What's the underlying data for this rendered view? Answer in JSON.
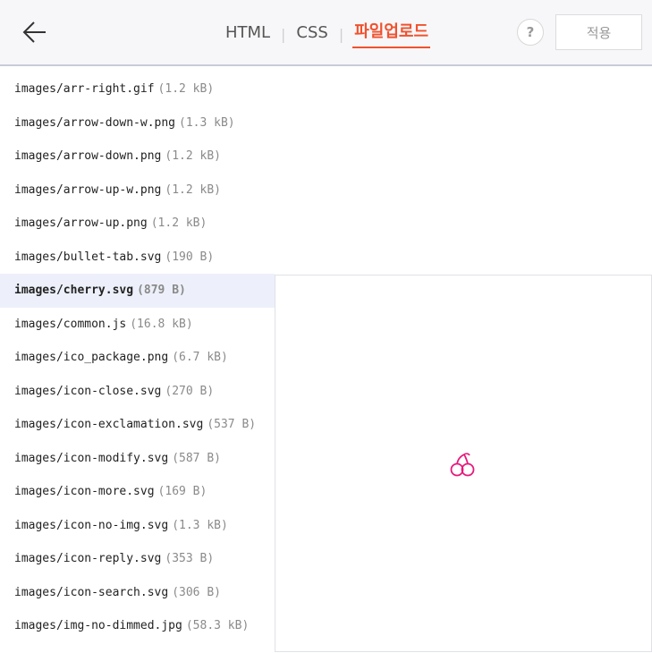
{
  "header": {
    "back_icon": "arrow-left-icon",
    "tabs": [
      {
        "label": "HTML",
        "active": false
      },
      {
        "label": "CSS",
        "active": false
      },
      {
        "label": "파일업로드",
        "active": true
      }
    ],
    "help_label": "?",
    "apply_label": "적용",
    "accent_color": "#f0522e"
  },
  "files": [
    {
      "name": "images/arr-right.gif",
      "size": "(1.2 kB)"
    },
    {
      "name": "images/arrow-down-w.png",
      "size": "(1.3 kB)"
    },
    {
      "name": "images/arrow-down.png",
      "size": "(1.2 kB)"
    },
    {
      "name": "images/arrow-up-w.png",
      "size": "(1.2 kB)"
    },
    {
      "name": "images/arrow-up.png",
      "size": "(1.2 kB)"
    },
    {
      "name": "images/bullet-tab.svg",
      "size": "(190 B)"
    },
    {
      "name": "images/cherry.svg",
      "size": "(879 B)",
      "selected": true
    },
    {
      "name": "images/common.js",
      "size": "(16.8 kB)"
    },
    {
      "name": "images/ico_package.png",
      "size": "(6.7 kB)"
    },
    {
      "name": "images/icon-close.svg",
      "size": "(270 B)"
    },
    {
      "name": "images/icon-exclamation.svg",
      "size": "(537 B)"
    },
    {
      "name": "images/icon-modify.svg",
      "size": "(587 B)"
    },
    {
      "name": "images/icon-more.svg",
      "size": "(169 B)"
    },
    {
      "name": "images/icon-no-img.svg",
      "size": "(1.3 kB)"
    },
    {
      "name": "images/icon-reply.svg",
      "size": "(353 B)"
    },
    {
      "name": "images/icon-search.svg",
      "size": "(306 B)"
    },
    {
      "name": "images/img-no-dimmed.jpg",
      "size": "(58.3 kB)"
    }
  ],
  "preview": {
    "icon": "cherry-icon",
    "color": "#e6197a"
  }
}
